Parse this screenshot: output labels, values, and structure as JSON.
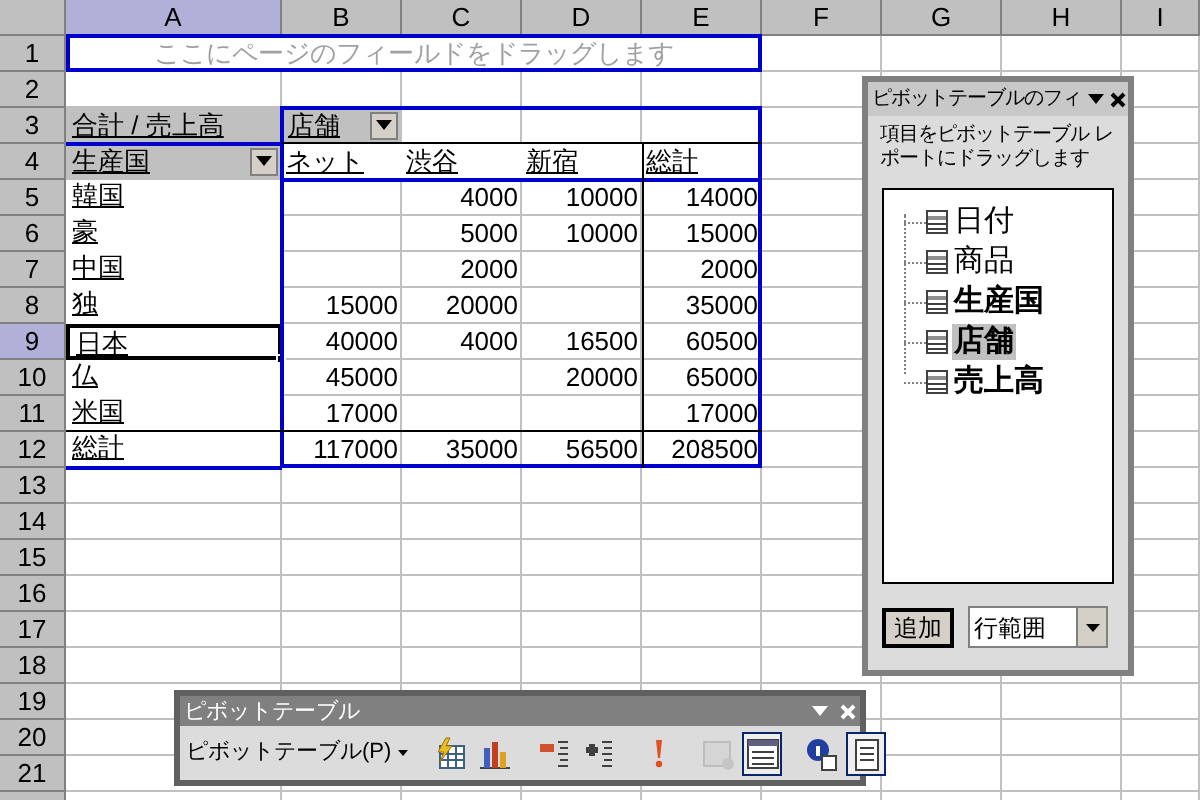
{
  "columns": [
    {
      "label": "A",
      "selected": true
    },
    {
      "label": "B",
      "selected": false
    },
    {
      "label": "C",
      "selected": false
    },
    {
      "label": "D",
      "selected": false
    },
    {
      "label": "E",
      "selected": false
    },
    {
      "label": "F",
      "selected": false
    },
    {
      "label": "G",
      "selected": false
    },
    {
      "label": "H",
      "selected": false
    },
    {
      "label": "I",
      "selected": false
    }
  ],
  "rows": [
    {
      "label": "1",
      "selected": false
    },
    {
      "label": "2",
      "selected": false
    },
    {
      "label": "3",
      "selected": false
    },
    {
      "label": "4",
      "selected": false
    },
    {
      "label": "5",
      "selected": false
    },
    {
      "label": "6",
      "selected": false
    },
    {
      "label": "7",
      "selected": false
    },
    {
      "label": "8",
      "selected": false
    },
    {
      "label": "9",
      "selected": true
    },
    {
      "label": "10",
      "selected": false
    },
    {
      "label": "11",
      "selected": false
    },
    {
      "label": "12",
      "selected": false
    },
    {
      "label": "13",
      "selected": false
    },
    {
      "label": "14",
      "selected": false
    },
    {
      "label": "15",
      "selected": false
    },
    {
      "label": "16",
      "selected": false
    },
    {
      "label": "17",
      "selected": false
    },
    {
      "label": "18",
      "selected": false
    },
    {
      "label": "19",
      "selected": false
    },
    {
      "label": "20",
      "selected": false
    },
    {
      "label": "21",
      "selected": false
    }
  ],
  "page_area": {
    "hint": "ここにページのフィールドをドラッグします"
  },
  "pivot": {
    "data_field": "合計 / 売上高",
    "column_field": "店舗",
    "row_field": "生産国",
    "column_items": [
      "ネット",
      "渋谷",
      "新宿",
      "総計"
    ],
    "rows": [
      {
        "label": "韓国",
        "selected": false,
        "values": {
          "column_2": "4000",
          "column_3": "10000",
          "column_4": "14000"
        }
      },
      {
        "label": "豪",
        "selected": false,
        "values": {
          "column_2": "5000",
          "column_3": "10000",
          "column_4": "15000"
        }
      },
      {
        "label": "中国",
        "selected": false,
        "values": {
          "column_2": "2000",
          "column_4": "2000"
        }
      },
      {
        "label": "独",
        "selected": false,
        "values": {
          "column_1": "15000",
          "column_2": "20000",
          "column_4": "35000"
        }
      },
      {
        "label": "日本",
        "selected": true,
        "values": {
          "column_1": "40000",
          "column_2": "4000",
          "column_3": "16500",
          "column_4": "60500"
        }
      },
      {
        "label": "仏",
        "selected": false,
        "values": {
          "column_1": "45000",
          "column_3": "20000",
          "column_4": "65000"
        }
      },
      {
        "label": "米国",
        "selected": false,
        "values": {
          "column_1": "17000",
          "column_4": "17000"
        }
      },
      {
        "label": "総計",
        "selected": false,
        "values": {
          "column_1": "117000",
          "column_2": "35000",
          "column_3": "56500",
          "column_4": "208500"
        }
      }
    ]
  },
  "field_list": {
    "title": "ピボットテーブルのフィ",
    "instructions": "項目をピボットテーブル レポートにドラッグします",
    "fields": [
      {
        "label": "日付",
        "in_use": false,
        "selected": false
      },
      {
        "label": "商品",
        "in_use": false,
        "selected": false
      },
      {
        "label": "生産国",
        "in_use": true,
        "selected": false
      },
      {
        "label": "店舗",
        "in_use": true,
        "selected": true
      },
      {
        "label": "売上高",
        "in_use": true,
        "selected": false
      }
    ],
    "add_button": "追加",
    "area_select": "行範囲"
  },
  "toolbar": {
    "title": "ピボットテーブル",
    "menu": "ピボットテーブル(P)",
    "buttons": [
      {
        "kind": "format",
        "pressed": false,
        "disabled": false
      },
      {
        "kind": "chart",
        "pressed": false,
        "disabled": false
      },
      {
        "kind": "hide",
        "pressed": false,
        "disabled": false
      },
      {
        "kind": "show",
        "pressed": false,
        "disabled": false
      },
      {
        "kind": "refresh",
        "pressed": false,
        "disabled": false
      },
      {
        "kind": "settings",
        "pressed": false,
        "disabled": true
      },
      {
        "kind": "fieldlist",
        "pressed": true,
        "disabled": false
      },
      {
        "kind": "info",
        "pressed": false,
        "disabled": false
      },
      {
        "kind": "hidefields",
        "pressed": true,
        "disabled": false
      }
    ]
  }
}
